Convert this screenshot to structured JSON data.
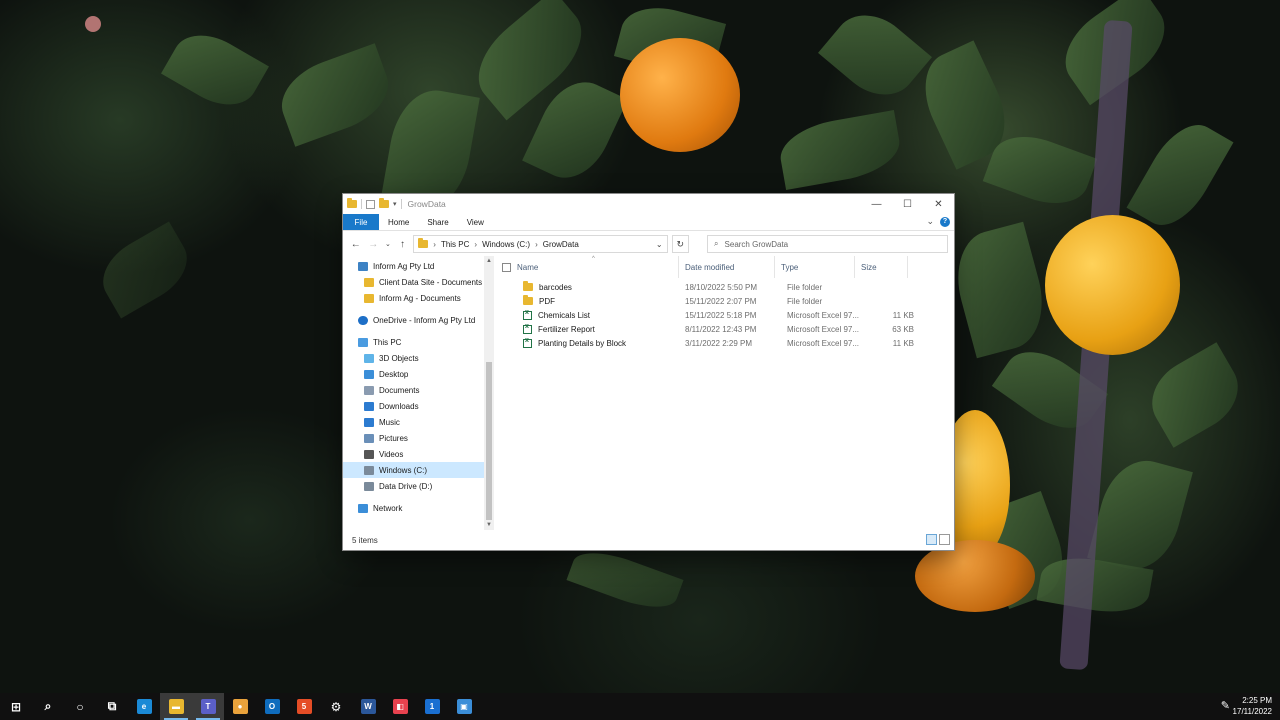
{
  "window": {
    "title": "GrowData",
    "controls": {
      "minimize": "—",
      "maximize": "☐",
      "close": "✕"
    }
  },
  "ribbon": {
    "tabs": [
      "File",
      "Home",
      "Share",
      "View"
    ],
    "expand": "⌄",
    "help": "?"
  },
  "address": {
    "crumbs": [
      "This PC",
      "Windows (C:)",
      "GrowData"
    ],
    "search_placeholder": "Search GrowData"
  },
  "nav": {
    "items": [
      {
        "label": "Inform Ag Pty Ltd",
        "indent": 1,
        "icon": "building-icon"
      },
      {
        "label": "Client Data Site - Documents",
        "indent": 2,
        "icon": "folder-icon"
      },
      {
        "label": "Inform Ag - Documents",
        "indent": 2,
        "icon": "folder-icon"
      },
      {
        "label": "",
        "indent": 0,
        "icon": ""
      },
      {
        "label": "OneDrive - Inform Ag Pty Ltd",
        "indent": 1,
        "icon": "cloud-icon"
      },
      {
        "label": "",
        "indent": 0,
        "icon": ""
      },
      {
        "label": "This PC",
        "indent": 1,
        "icon": "pc-icon"
      },
      {
        "label": "3D Objects",
        "indent": 2,
        "icon": "cube-icon"
      },
      {
        "label": "Desktop",
        "indent": 2,
        "icon": "desktop-icon"
      },
      {
        "label": "Documents",
        "indent": 2,
        "icon": "document-icon"
      },
      {
        "label": "Downloads",
        "indent": 2,
        "icon": "download-icon"
      },
      {
        "label": "Music",
        "indent": 2,
        "icon": "music-icon"
      },
      {
        "label": "Pictures",
        "indent": 2,
        "icon": "picture-icon"
      },
      {
        "label": "Videos",
        "indent": 2,
        "icon": "video-icon"
      },
      {
        "label": "Windows (C:)",
        "indent": 2,
        "icon": "drive-icon",
        "selected": true
      },
      {
        "label": "Data Drive (D:)",
        "indent": 2,
        "icon": "drive-icon"
      },
      {
        "label": "",
        "indent": 0,
        "icon": ""
      },
      {
        "label": "Network",
        "indent": 1,
        "icon": "network-icon"
      }
    ]
  },
  "columns": {
    "name": "Name",
    "date": "Date modified",
    "type": "Type",
    "size": "Size"
  },
  "files": [
    {
      "name": "barcodes",
      "date": "18/10/2022 5:50 PM",
      "type": "File folder",
      "size": "",
      "kind": "folder"
    },
    {
      "name": "PDF",
      "date": "15/11/2022 2:07 PM",
      "type": "File folder",
      "size": "",
      "kind": "folder"
    },
    {
      "name": "Chemicals List",
      "date": "15/11/2022 5:18 PM",
      "type": "Microsoft Excel 97...",
      "size": "11 KB",
      "kind": "excel"
    },
    {
      "name": "Fertilizer Report",
      "date": "8/11/2022 12:43 PM",
      "type": "Microsoft Excel 97...",
      "size": "63 KB",
      "kind": "excel"
    },
    {
      "name": "Planting Details by Block",
      "date": "3/11/2022 2:29 PM",
      "type": "Microsoft Excel 97...",
      "size": "11 KB",
      "kind": "excel"
    }
  ],
  "status": {
    "count": "5 items"
  },
  "taskbar": {
    "apps": [
      {
        "name": "start-button",
        "glyph": "⊞",
        "color": "#101010"
      },
      {
        "name": "search-button",
        "glyph": "⌕",
        "color": "#101010"
      },
      {
        "name": "cortana-button",
        "glyph": "○",
        "color": "#101010"
      },
      {
        "name": "task-view-button",
        "glyph": "⧉",
        "color": "#101010"
      },
      {
        "name": "edge-app",
        "glyph": "e",
        "color": "#1b8ad6"
      },
      {
        "name": "file-explorer-app",
        "glyph": "▬",
        "color": "#e8b730",
        "active": true
      },
      {
        "name": "teams-app",
        "glyph": "T",
        "color": "#5b5fc7",
        "active": true
      },
      {
        "name": "chrome-app",
        "glyph": "●",
        "color": "#e9a23b"
      },
      {
        "name": "outlook-app",
        "glyph": "O",
        "color": "#0f6cbd"
      },
      {
        "name": "html-editor-app",
        "glyph": "5",
        "color": "#e54d26"
      },
      {
        "name": "settings-app",
        "glyph": "⚙",
        "color": "#101010"
      },
      {
        "name": "word-app",
        "glyph": "W",
        "color": "#2b579a"
      },
      {
        "name": "snip-app",
        "glyph": "◧",
        "color": "#e8424f"
      },
      {
        "name": "password-app",
        "glyph": "1",
        "color": "#1a6fd1"
      },
      {
        "name": "remote-app",
        "glyph": "▣",
        "color": "#3b8ed8"
      }
    ],
    "time": "2:25 PM",
    "date": "17/11/2022"
  },
  "colors": {
    "accent": "#1979ca",
    "selection": "#cce8ff",
    "header_text": "#4c607a"
  }
}
